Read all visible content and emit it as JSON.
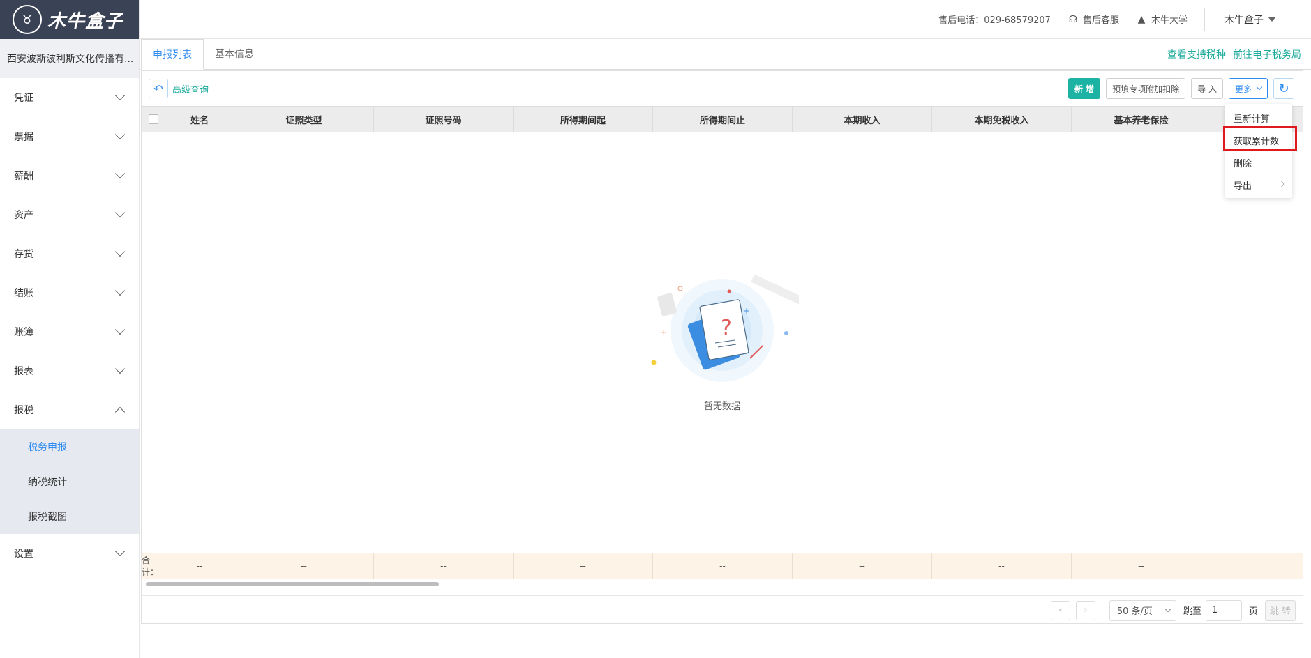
{
  "brand": {
    "logo_text": "木牛盒子",
    "logo_glyph": "♉"
  },
  "company": "西安波斯波利斯文化传播有...",
  "sidebar": {
    "items": [
      {
        "label": "凭证",
        "expanded": false
      },
      {
        "label": "票据",
        "expanded": false
      },
      {
        "label": "薪酬",
        "expanded": false
      },
      {
        "label": "资产",
        "expanded": false
      },
      {
        "label": "存货",
        "expanded": false
      },
      {
        "label": "结账",
        "expanded": false
      },
      {
        "label": "账簿",
        "expanded": false
      },
      {
        "label": "报表",
        "expanded": false
      },
      {
        "label": "报税",
        "expanded": true
      }
    ],
    "sub_items": [
      {
        "label": "税务申报",
        "active": true
      },
      {
        "label": "纳税统计",
        "active": false
      },
      {
        "label": "报税截图",
        "active": false
      }
    ],
    "settings": {
      "label": "设置"
    }
  },
  "header": {
    "phone": "售后电话：029-68579207",
    "service": "售后客服",
    "university": "木牛大学",
    "user": "木牛盒子"
  },
  "tabs": [
    {
      "label": "申报列表",
      "active": true
    },
    {
      "label": "基本信息",
      "active": false
    }
  ],
  "tab_links": {
    "view_tax_types": "查看支持税种",
    "goto_tax_bureau": "前往电子税务局"
  },
  "toolbar": {
    "advanced_query": "高级查询",
    "add": "新 增",
    "prefill": "预填专项附加扣除",
    "import": "导 入",
    "more": "更多"
  },
  "table": {
    "columns": [
      "姓名",
      "证照类型",
      "证照号码",
      "所得期间起",
      "所得期间止",
      "本期收入",
      "本期免税收入",
      "基本养老保险"
    ],
    "summary_label": "合计：",
    "summary_values": [
      "--",
      "--",
      "--",
      "--",
      "--",
      "--",
      "--",
      "--"
    ],
    "empty_text": "暂无数据"
  },
  "pagination": {
    "page_size": "50 条/页",
    "jump_label": "跳至",
    "page_value": "1",
    "page_suffix": "页",
    "jump_button": "跳 转"
  },
  "more_menu": {
    "items": [
      "重新计算",
      "获取累计数",
      "删除",
      "导出"
    ]
  },
  "colors": {
    "accent": "#1cb3a4",
    "link_blue": "#2d8cf0",
    "highlight": "#e0191f",
    "sidebar_dark": "#3a4356"
  }
}
